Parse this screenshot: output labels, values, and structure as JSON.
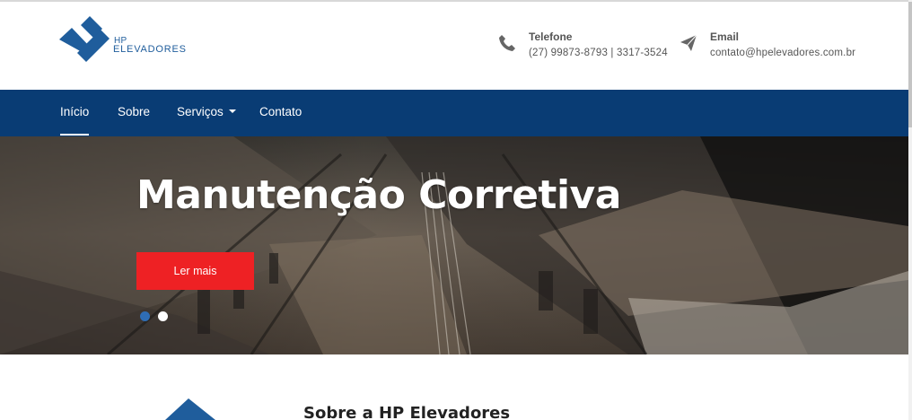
{
  "brand": {
    "logo_top": "HP",
    "logo_name": "ELEVADORES",
    "primary_color": "#093c74",
    "accent_color": "#ee2124",
    "logo_color": "#1f5d9c"
  },
  "contact": {
    "phone": {
      "icon": "phone-icon",
      "label": "Telefone",
      "value": "(27) 99873-8793 | 3317-3524"
    },
    "email": {
      "icon": "paper-plane-icon",
      "label": "Email",
      "value": "contato@hpelevadores.com.br"
    }
  },
  "nav": {
    "items": [
      {
        "label": "Início",
        "active": true
      },
      {
        "label": "Sobre",
        "active": false
      },
      {
        "label": "Serviços",
        "active": false,
        "dropdown": true
      },
      {
        "label": "Contato",
        "active": false
      }
    ]
  },
  "hero": {
    "title": "Manutenção Corretiva",
    "button_label": "Ler mais",
    "slides_count": 2,
    "active_slide": 1
  },
  "about": {
    "title": "Sobre a HP Elevadores"
  }
}
